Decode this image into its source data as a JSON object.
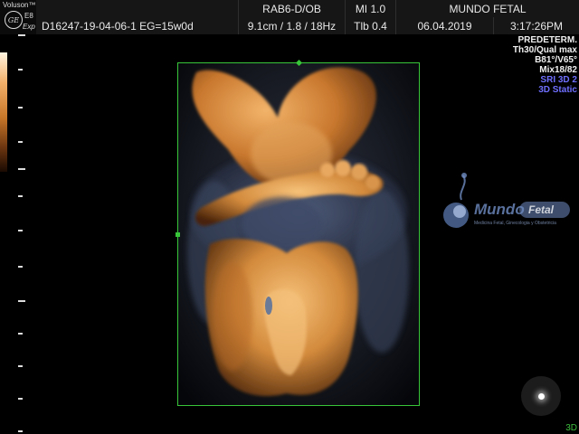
{
  "header": {
    "brand": "Voluson™",
    "ge_mark": "GE",
    "model": "E8",
    "exp": "Exp",
    "row1": {
      "blank": "",
      "probe_preset": "RAB6-D/OB",
      "mi": "MI  1.0",
      "institution": "MUNDO FETAL"
    },
    "row2": {
      "patient_id": "D16247-19-04-06-1  EG=15w0d",
      "depth_freq": "9.1cm / 1.8 / 18Hz",
      "tib": "Tlb  0.4",
      "date": "06.04.2019",
      "time": "3:17:26PM"
    }
  },
  "right_panel": {
    "lines": [
      {
        "text": "PREDETERM.",
        "color": "white"
      },
      {
        "text": "Th30/Qual max",
        "color": "white"
      },
      {
        "text": "B81°/V65°",
        "color": "white"
      },
      {
        "text": "Mix18/82",
        "color": "white"
      },
      {
        "text": "SRI 3D 2",
        "color": "blue"
      },
      {
        "text": "3D Static",
        "color": "blue"
      }
    ]
  },
  "watermark": {
    "name": "Mundo",
    "name_badge": "Fetal",
    "tagline": "Medicina Fetal, Ginecologia y Obstetricia"
  },
  "mode_label": "3D",
  "colors": {
    "roi": "#39c53a",
    "accent_blue": "#6f6fff",
    "render_skin": "#d98a3c"
  }
}
